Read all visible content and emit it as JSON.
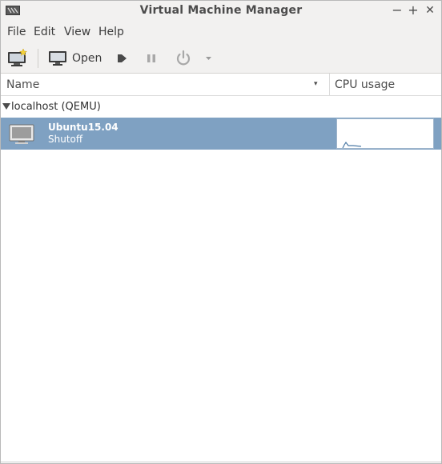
{
  "window": {
    "title": "Virtual Machine Manager",
    "controls": {
      "minimize": "−",
      "maximize": "+",
      "close": "✕"
    }
  },
  "menu": [
    "File",
    "Edit",
    "View",
    "Help"
  ],
  "toolbar": {
    "new_vm_icon": "monitor-star-icon",
    "open_label": "Open",
    "run_icon": "play-icon",
    "pause_icon": "pause-icon",
    "shutdown_icon": "power-icon",
    "dropdown_icon": "chevron-down-icon"
  },
  "columns": {
    "name": "Name",
    "sort_indicator": "▾",
    "cpu": "CPU usage"
  },
  "connection": {
    "label": "localhost (QEMU)"
  },
  "vms": [
    {
      "name": "Ubuntu15.04",
      "status": "Shutoff",
      "icon": "monitor-icon"
    }
  ],
  "colors": {
    "selection": "#7fa1c2",
    "chrome": "#f2f1f0"
  }
}
